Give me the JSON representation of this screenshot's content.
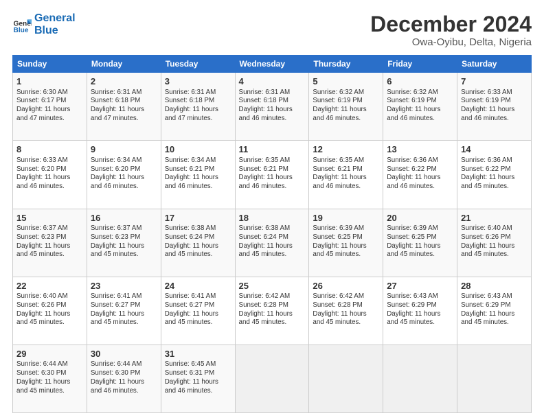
{
  "header": {
    "logo_line1": "General",
    "logo_line2": "Blue",
    "title": "December 2024",
    "subtitle": "Owa-Oyibu, Delta, Nigeria"
  },
  "calendar": {
    "days_of_week": [
      "Sunday",
      "Monday",
      "Tuesday",
      "Wednesday",
      "Thursday",
      "Friday",
      "Saturday"
    ],
    "weeks": [
      [
        {
          "day": "1",
          "info": "Sunrise: 6:30 AM\nSunset: 6:17 PM\nDaylight: 11 hours\nand 47 minutes."
        },
        {
          "day": "2",
          "info": "Sunrise: 6:31 AM\nSunset: 6:18 PM\nDaylight: 11 hours\nand 47 minutes."
        },
        {
          "day": "3",
          "info": "Sunrise: 6:31 AM\nSunset: 6:18 PM\nDaylight: 11 hours\nand 47 minutes."
        },
        {
          "day": "4",
          "info": "Sunrise: 6:31 AM\nSunset: 6:18 PM\nDaylight: 11 hours\nand 46 minutes."
        },
        {
          "day": "5",
          "info": "Sunrise: 6:32 AM\nSunset: 6:19 PM\nDaylight: 11 hours\nand 46 minutes."
        },
        {
          "day": "6",
          "info": "Sunrise: 6:32 AM\nSunset: 6:19 PM\nDaylight: 11 hours\nand 46 minutes."
        },
        {
          "day": "7",
          "info": "Sunrise: 6:33 AM\nSunset: 6:19 PM\nDaylight: 11 hours\nand 46 minutes."
        }
      ],
      [
        {
          "day": "8",
          "info": "Sunrise: 6:33 AM\nSunset: 6:20 PM\nDaylight: 11 hours\nand 46 minutes."
        },
        {
          "day": "9",
          "info": "Sunrise: 6:34 AM\nSunset: 6:20 PM\nDaylight: 11 hours\nand 46 minutes."
        },
        {
          "day": "10",
          "info": "Sunrise: 6:34 AM\nSunset: 6:21 PM\nDaylight: 11 hours\nand 46 minutes."
        },
        {
          "day": "11",
          "info": "Sunrise: 6:35 AM\nSunset: 6:21 PM\nDaylight: 11 hours\nand 46 minutes."
        },
        {
          "day": "12",
          "info": "Sunrise: 6:35 AM\nSunset: 6:21 PM\nDaylight: 11 hours\nand 46 minutes."
        },
        {
          "day": "13",
          "info": "Sunrise: 6:36 AM\nSunset: 6:22 PM\nDaylight: 11 hours\nand 46 minutes."
        },
        {
          "day": "14",
          "info": "Sunrise: 6:36 AM\nSunset: 6:22 PM\nDaylight: 11 hours\nand 45 minutes."
        }
      ],
      [
        {
          "day": "15",
          "info": "Sunrise: 6:37 AM\nSunset: 6:23 PM\nDaylight: 11 hours\nand 45 minutes."
        },
        {
          "day": "16",
          "info": "Sunrise: 6:37 AM\nSunset: 6:23 PM\nDaylight: 11 hours\nand 45 minutes."
        },
        {
          "day": "17",
          "info": "Sunrise: 6:38 AM\nSunset: 6:24 PM\nDaylight: 11 hours\nand 45 minutes."
        },
        {
          "day": "18",
          "info": "Sunrise: 6:38 AM\nSunset: 6:24 PM\nDaylight: 11 hours\nand 45 minutes."
        },
        {
          "day": "19",
          "info": "Sunrise: 6:39 AM\nSunset: 6:25 PM\nDaylight: 11 hours\nand 45 minutes."
        },
        {
          "day": "20",
          "info": "Sunrise: 6:39 AM\nSunset: 6:25 PM\nDaylight: 11 hours\nand 45 minutes."
        },
        {
          "day": "21",
          "info": "Sunrise: 6:40 AM\nSunset: 6:26 PM\nDaylight: 11 hours\nand 45 minutes."
        }
      ],
      [
        {
          "day": "22",
          "info": "Sunrise: 6:40 AM\nSunset: 6:26 PM\nDaylight: 11 hours\nand 45 minutes."
        },
        {
          "day": "23",
          "info": "Sunrise: 6:41 AM\nSunset: 6:27 PM\nDaylight: 11 hours\nand 45 minutes."
        },
        {
          "day": "24",
          "info": "Sunrise: 6:41 AM\nSunset: 6:27 PM\nDaylight: 11 hours\nand 45 minutes."
        },
        {
          "day": "25",
          "info": "Sunrise: 6:42 AM\nSunset: 6:28 PM\nDaylight: 11 hours\nand 45 minutes."
        },
        {
          "day": "26",
          "info": "Sunrise: 6:42 AM\nSunset: 6:28 PM\nDaylight: 11 hours\nand 45 minutes."
        },
        {
          "day": "27",
          "info": "Sunrise: 6:43 AM\nSunset: 6:29 PM\nDaylight: 11 hours\nand 45 minutes."
        },
        {
          "day": "28",
          "info": "Sunrise: 6:43 AM\nSunset: 6:29 PM\nDaylight: 11 hours\nand 45 minutes."
        }
      ],
      [
        {
          "day": "29",
          "info": "Sunrise: 6:44 AM\nSunset: 6:30 PM\nDaylight: 11 hours\nand 45 minutes."
        },
        {
          "day": "30",
          "info": "Sunrise: 6:44 AM\nSunset: 6:30 PM\nDaylight: 11 hours\nand 46 minutes."
        },
        {
          "day": "31",
          "info": "Sunrise: 6:45 AM\nSunset: 6:31 PM\nDaylight: 11 hours\nand 46 minutes."
        },
        {
          "day": "",
          "info": ""
        },
        {
          "day": "",
          "info": ""
        },
        {
          "day": "",
          "info": ""
        },
        {
          "day": "",
          "info": ""
        }
      ]
    ]
  }
}
